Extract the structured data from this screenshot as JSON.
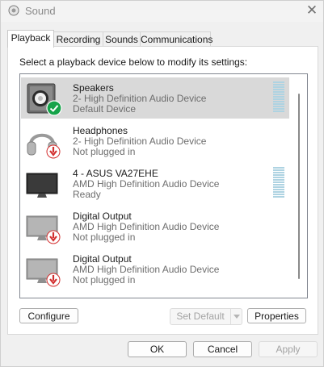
{
  "window": {
    "title": "Sound",
    "close_glyph": "✕"
  },
  "tabs": [
    {
      "label": "Playback",
      "active": true
    },
    {
      "label": "Recording",
      "active": false
    },
    {
      "label": "Sounds",
      "active": false
    },
    {
      "label": "Communications",
      "active": false
    }
  ],
  "panel": {
    "instructions": "Select a playback device below to modify its settings:"
  },
  "devices": [
    {
      "name": "Speakers",
      "description": "2- High Definition Audio Device",
      "status": "Default Device",
      "icon": "speaker-icon",
      "badge": "default-check-icon",
      "selected": true,
      "meter": true
    },
    {
      "name": "Headphones",
      "description": "2- High Definition Audio Device",
      "status": "Not plugged in",
      "icon": "headphones-icon",
      "badge": "unplugged-arrow-icon",
      "selected": false,
      "meter": false
    },
    {
      "name": "4 - ASUS VA27EHE",
      "description": "AMD High Definition Audio Device",
      "status": "Ready",
      "icon": "monitor-icon",
      "badge": "",
      "selected": false,
      "meter": true
    },
    {
      "name": "Digital Output",
      "description": "AMD High Definition Audio Device",
      "status": "Not plugged in",
      "icon": "monitor-icon",
      "badge": "unplugged-arrow-icon",
      "selected": false,
      "meter": false
    },
    {
      "name": "Digital Output",
      "description": "AMD High Definition Audio Device",
      "status": "Not plugged in",
      "icon": "monitor-icon",
      "badge": "unplugged-arrow-icon",
      "selected": false,
      "meter": false
    }
  ],
  "buttons": {
    "configure": "Configure",
    "set_default": "Set Default",
    "properties": "Properties",
    "ok": "OK",
    "cancel": "Cancel",
    "apply": "Apply"
  },
  "colors": {
    "window_bg": "#f0f0f0",
    "selected_row": "#d9d9d9",
    "check_green": "#16a34a",
    "unplugged_red": "#d32f2f",
    "meter_blue": "#aed3e2"
  }
}
